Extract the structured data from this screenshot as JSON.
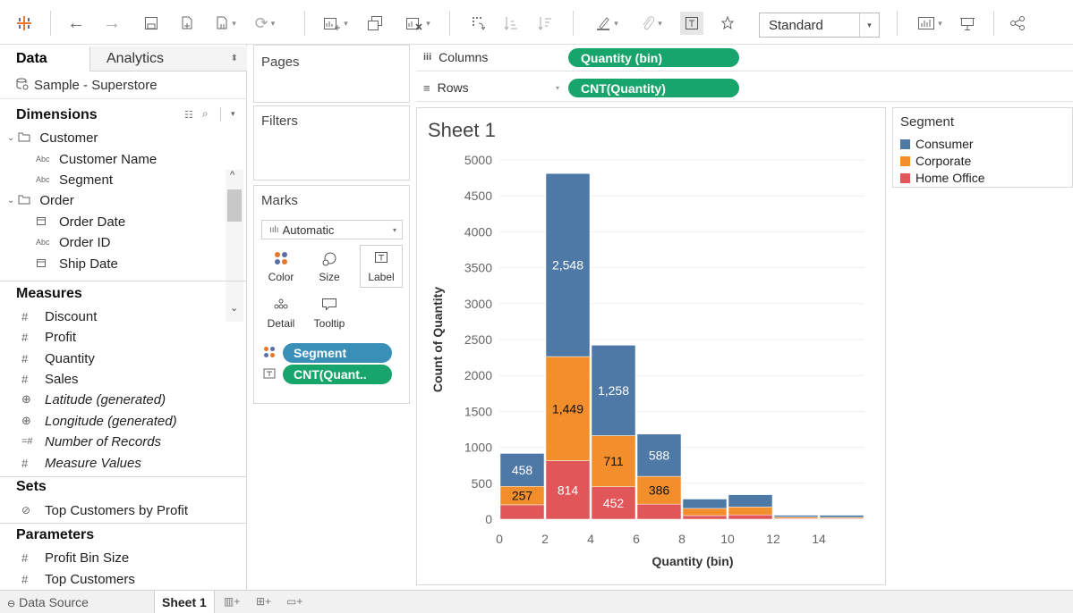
{
  "toolbar": {
    "fit_value": "Standard",
    "icons": [
      "tableau-logo-icon",
      "back-icon",
      "forward-icon",
      "save-icon",
      "new-datasource-icon",
      "pause-updates-icon",
      "refresh-icon",
      "new-worksheet-icon",
      "duplicate-icon",
      "clear-sheet-icon",
      "swap-icon",
      "sort-ascending-icon",
      "sort-descending-icon",
      "highlight-icon",
      "group-icon",
      "show-labels-icon",
      "fix-axes-icon",
      "show-me-icon",
      "presentation-icon",
      "share-icon"
    ]
  },
  "data_pane": {
    "tabs": {
      "data": "Data",
      "analytics": "Analytics"
    },
    "datasource": "Sample - Superstore",
    "dimensions_header": "Dimensions",
    "dimensions": [
      {
        "label": "Customer",
        "type": "folder"
      },
      {
        "label": "Customer Name",
        "type": "abc"
      },
      {
        "label": "Segment",
        "type": "abc"
      },
      {
        "label": "Order",
        "type": "folder"
      },
      {
        "label": "Order Date",
        "type": "date"
      },
      {
        "label": "Order ID",
        "type": "abc"
      },
      {
        "label": "Ship Date",
        "type": "date"
      }
    ],
    "measures_header": "Measures",
    "measures": [
      {
        "label": "Discount",
        "italic": false
      },
      {
        "label": "Profit",
        "italic": false
      },
      {
        "label": "Quantity",
        "italic": false
      },
      {
        "label": "Sales",
        "italic": false
      },
      {
        "label": "Latitude (generated)",
        "italic": true
      },
      {
        "label": "Longitude (generated)",
        "italic": true
      },
      {
        "label": "Number of Records",
        "italic": true
      },
      {
        "label": "Measure Values",
        "italic": true
      }
    ],
    "sets_header": "Sets",
    "sets": [
      "Top Customers by Profit"
    ],
    "parameters_header": "Parameters",
    "parameters": [
      "Profit Bin Size",
      "Top Customers"
    ]
  },
  "shelves": {
    "pages": "Pages",
    "filters": "Filters",
    "columns_label": "Columns",
    "columns_pill": "Quantity (bin)",
    "rows_label": "Rows",
    "rows_pill": "CNT(Quantity)"
  },
  "marks": {
    "title": "Marks",
    "type": "Automatic",
    "buttons": {
      "color": "Color",
      "size": "Size",
      "label": "Label",
      "detail": "Detail",
      "tooltip": "Tooltip"
    },
    "pills": [
      {
        "label": "Segment",
        "color": "#3a8fb7"
      },
      {
        "label": "CNT(Quant..",
        "color": "#17a56c"
      }
    ]
  },
  "sheet": {
    "title": "Sheet 1"
  },
  "legend": {
    "title": "Segment",
    "items": [
      {
        "label": "Consumer",
        "color": "#4e79a7"
      },
      {
        "label": "Corporate",
        "color": "#f28e2b"
      },
      {
        "label": "Home Office",
        "color": "#e15759"
      }
    ]
  },
  "bottom": {
    "data_source": "Data Source",
    "sheet_tab": "Sheet 1"
  },
  "chart_data": {
    "type": "bar",
    "stacked": true,
    "xlabel": "Quantity (bin)",
    "ylabel": "Count of Quantity",
    "ylim": [
      0,
      5000
    ],
    "yticks": [
      0,
      500,
      1000,
      1500,
      2000,
      2500,
      3000,
      3500,
      4000,
      4500,
      5000
    ],
    "xticks": [
      0,
      2,
      4,
      6,
      8,
      10,
      12,
      14
    ],
    "bin_width": 2,
    "bins": [
      0,
      2,
      4,
      6,
      8,
      10,
      12,
      14
    ],
    "series": [
      {
        "name": "Home Office",
        "color": "#e15759",
        "values": [
          200,
          814,
          452,
          210,
          50,
          60,
          10,
          10
        ]
      },
      {
        "name": "Corporate",
        "color": "#f28e2b",
        "values": [
          257,
          1449,
          711,
          386,
          100,
          110,
          20,
          15
        ]
      },
      {
        "name": "Consumer",
        "color": "#4e79a7",
        "values": [
          458,
          2548,
          1258,
          588,
          130,
          170,
          25,
          30
        ]
      }
    ],
    "labels": [
      {
        "bin": 0,
        "series": "Corporate",
        "text": "257",
        "dark": true
      },
      {
        "bin": 0,
        "series": "Consumer",
        "text": "458",
        "dark": false
      },
      {
        "bin": 2,
        "series": "Home Office",
        "text": "814",
        "dark": false
      },
      {
        "bin": 2,
        "series": "Corporate",
        "text": "1,449",
        "dark": true
      },
      {
        "bin": 2,
        "series": "Consumer",
        "text": "2,548",
        "dark": false
      },
      {
        "bin": 4,
        "series": "Home Office",
        "text": "452",
        "dark": false
      },
      {
        "bin": 4,
        "series": "Corporate",
        "text": "711",
        "dark": true
      },
      {
        "bin": 4,
        "series": "Consumer",
        "text": "1,258",
        "dark": false
      },
      {
        "bin": 6,
        "series": "Corporate",
        "text": "386",
        "dark": true
      },
      {
        "bin": 6,
        "series": "Consumer",
        "text": "588",
        "dark": false
      }
    ]
  }
}
